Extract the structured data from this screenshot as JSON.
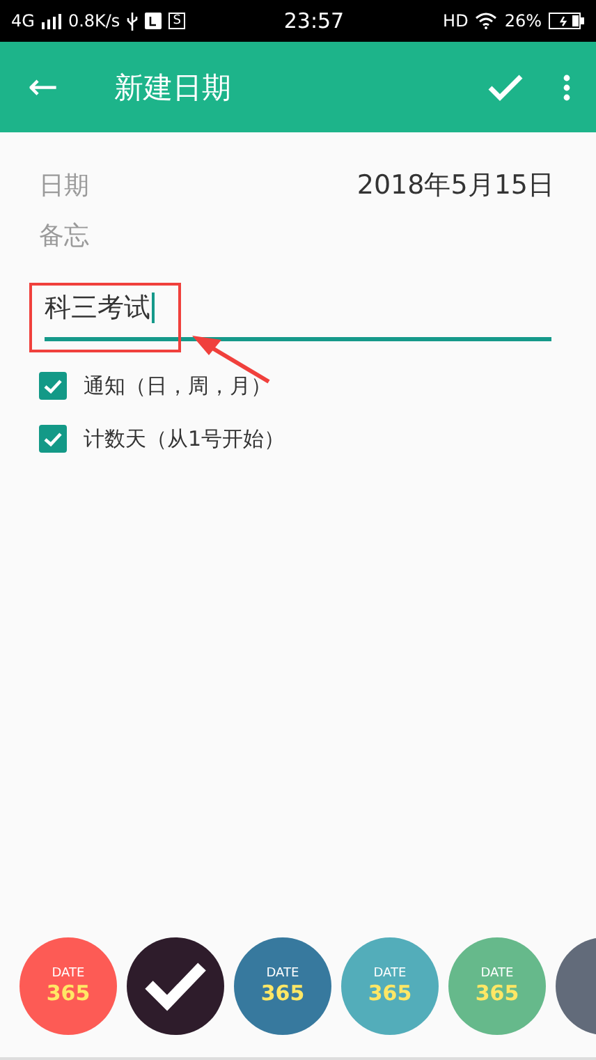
{
  "status_bar": {
    "network": "4G",
    "speed": "0.8K/s",
    "badge": "S",
    "time": "23:57",
    "hd": "HD",
    "battery": "26%"
  },
  "app_bar": {
    "back": "←",
    "title": "新建日期"
  },
  "date": {
    "label": "日期",
    "value": "2018年5月15日"
  },
  "memo": {
    "label": "备忘",
    "value": "科三考试"
  },
  "options": [
    {
      "label": "通知（日，周，月）",
      "checked": true
    },
    {
      "label": "计数天（从1号开始）",
      "checked": true
    }
  ],
  "themes": [
    {
      "caption": "DATE",
      "number": "365",
      "color": "#fd5b55",
      "selected": false
    },
    {
      "color": "#2e1c2b",
      "selected": true
    },
    {
      "caption": "DATE",
      "number": "365",
      "color": "#37799e",
      "selected": false
    },
    {
      "caption": "DATE",
      "number": "365",
      "color": "#53adba",
      "selected": false
    },
    {
      "caption": "DATE",
      "number": "365",
      "color": "#66b98b",
      "selected": false
    },
    {
      "color": "#626b7a",
      "selected": false
    }
  ]
}
